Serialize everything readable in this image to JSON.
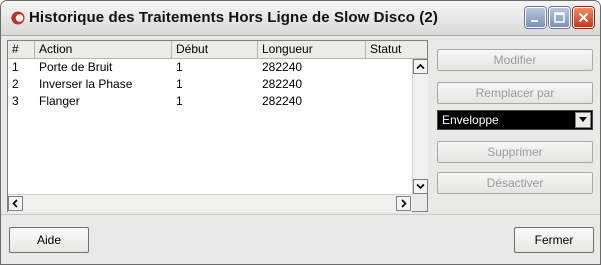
{
  "window": {
    "title": "Historique des Traitements Hors Ligne de Slow Disco (2)",
    "accent_color": "#c0302a"
  },
  "table": {
    "columns": [
      "#",
      "Action",
      "Début",
      "Longueur",
      "Statut"
    ],
    "rows": [
      {
        "num": "1",
        "action": "Porte de Bruit",
        "debut": "1",
        "longueur": "282240",
        "statut": ""
      },
      {
        "num": "2",
        "action": "Inverser la Phase",
        "debut": "1",
        "longueur": "282240",
        "statut": ""
      },
      {
        "num": "3",
        "action": "Flanger",
        "debut": "1",
        "longueur": "282240",
        "statut": ""
      }
    ]
  },
  "actions": {
    "modify_label": "Modifier",
    "replace_label": "Remplacer par",
    "replace_select_value": "Enveloppe",
    "delete_label": "Supprimer",
    "disable_label": "Désactiver"
  },
  "footer": {
    "help_label": "Aide",
    "close_label": "Fermer"
  }
}
